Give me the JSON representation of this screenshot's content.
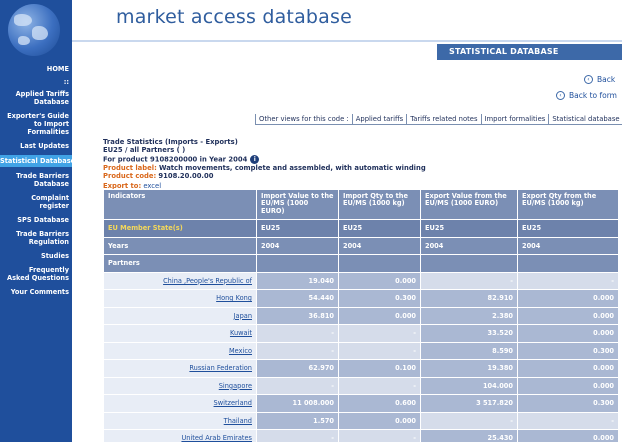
{
  "header": {
    "site_title": "market access database",
    "section_banner": "STATISTICAL DATABASE"
  },
  "sidebar": {
    "items": [
      {
        "label": "HOME"
      },
      {
        "label": "::"
      },
      {
        "label": "Applied Tariffs Database"
      },
      {
        "label": "Exporter's Guide to Import Formalities"
      },
      {
        "label": "Last Updates"
      },
      {
        "label": "Statistical Database",
        "active": true
      },
      {
        "label": "Trade Barriers Database"
      },
      {
        "label": "Complaint register"
      },
      {
        "label": "SPS Database"
      },
      {
        "label": "Trade Barriers Regulation"
      },
      {
        "label": "Studies"
      },
      {
        "label": "Frequently Asked Questions"
      },
      {
        "label": "Your Comments"
      }
    ]
  },
  "nav": {
    "back": "Back",
    "back_to_form": "Back to form"
  },
  "other_views": {
    "label": "Other views for this code :",
    "links": [
      "Applied tariffs",
      "Tariffs related notes",
      "Import formalities",
      "Statistical database"
    ]
  },
  "info": {
    "title": "Trade Statistics (Imports - Exports)",
    "subtitle": "EU25 / all Partners ( )",
    "product_line": "For product 9108200000 in Year 2004",
    "product_label_key": "Product label:",
    "product_label_value": "Watch movements, complete and assembled, with automatic winding",
    "product_code_key": "Product code:",
    "product_code_value": "9108.20.00.00",
    "export_key": "Export to:",
    "export_link": "excel"
  },
  "table": {
    "headers": [
      "Indicators",
      "Import Value to the EU/MS (1000 EURO)",
      "Import Qty to the EU/MS (1000 kg)",
      "Export Value from the EU/MS (1000 EURO)",
      "Export Qty from the EU/MS (1000 kg)"
    ],
    "member_state_label": "EU Member State(s)",
    "member_states": [
      "EU25",
      "EU25",
      "EU25",
      "EU25"
    ],
    "years_label": "Years",
    "years": [
      "2004",
      "2004",
      "2004",
      "2004"
    ],
    "partners_label": "Partners",
    "rows": [
      {
        "country": "China ,People's Republic of",
        "values": [
          "19.040",
          "0.000",
          "-",
          "-"
        ]
      },
      {
        "country": "Hong Kong",
        "values": [
          "54.440",
          "0.300",
          "82.910",
          "0.000"
        ]
      },
      {
        "country": "Japan",
        "values": [
          "36.810",
          "0.000",
          "2.380",
          "0.000"
        ]
      },
      {
        "country": "Kuwait",
        "values": [
          "-",
          "-",
          "33.520",
          "0.000"
        ]
      },
      {
        "country": "Mexico",
        "values": [
          "-",
          "-",
          "8.590",
          "0.300"
        ]
      },
      {
        "country": "Russian Federation",
        "values": [
          "62.970",
          "0.100",
          "19.380",
          "0.000"
        ]
      },
      {
        "country": "Singapore",
        "values": [
          "-",
          "-",
          "104.000",
          "0.000"
        ]
      },
      {
        "country": "Switzerland",
        "values": [
          "11 008.000",
          "0.600",
          "3 517.820",
          "0.300"
        ]
      },
      {
        "country": "Thailand",
        "values": [
          "1.570",
          "0.000",
          "-",
          "-"
        ]
      },
      {
        "country": "United Arab Emirates",
        "values": [
          "-",
          "-",
          "25.430",
          "0.000"
        ]
      }
    ]
  }
}
